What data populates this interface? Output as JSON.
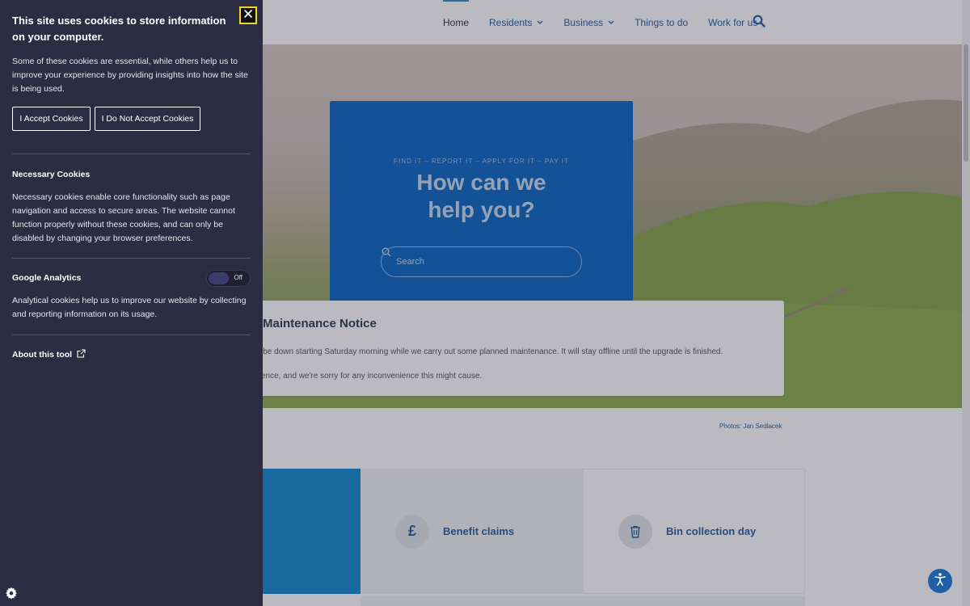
{
  "nav": {
    "items": [
      {
        "label": "Home",
        "active": true,
        "has_dropdown": false
      },
      {
        "label": "Residents",
        "active": false,
        "has_dropdown": true
      },
      {
        "label": "Business",
        "active": false,
        "has_dropdown": true
      },
      {
        "label": "Things to do",
        "active": false,
        "has_dropdown": false
      },
      {
        "label": "Work for us",
        "active": false,
        "has_dropdown": false
      }
    ],
    "search_icon": "search-icon"
  },
  "hero": {
    "eyebrow": "FIND IT – REPORT IT – APPLY FOR IT – PAY IT",
    "title_line1": "How can we",
    "title_line2": "help you?",
    "search_placeholder": "Search",
    "box_color": "#0a66c2"
  },
  "notice": {
    "title": "Maintenance Notice",
    "line1": "ll be down starting Saturday morning while we carry out some planned maintenance. It will stay offline until the upgrade is finished.",
    "line2": "tience, and we're sorry for any inconvenience this might cause."
  },
  "photo_credit": "Photos: Jan Sedlacek",
  "tiles": [
    {
      "label": "Benefit claims",
      "icon": "pound-icon"
    },
    {
      "label": "Bin collection day",
      "icon": "trash-icon"
    }
  ],
  "cookie_panel": {
    "title": "This site uses cookies to store information on your computer.",
    "intro": "Some of these cookies are essential, while others help us to improve your experience by providing insights into how the site is being used.",
    "accept_label": "I Accept Cookies",
    "decline_label": "I Do Not Accept Cookies",
    "necessary": {
      "heading": "Necessary Cookies",
      "text": "Necessary cookies enable core functionality such as page navigation and access to secure areas. The website cannot function properly without these cookies, and can only be disabled by changing your browser preferences."
    },
    "analytics": {
      "heading": "Google Analytics",
      "toggle_state": "Off",
      "text": "Analytical cookies help us to improve our website by collecting and reporting information on its usage."
    },
    "about_link": "About this tool",
    "panel_color": "#2c2c43",
    "close_focus_color": "#f5d321"
  },
  "colors": {
    "link_blue": "#1f5fa6",
    "tile_blue": "#1286ce"
  }
}
